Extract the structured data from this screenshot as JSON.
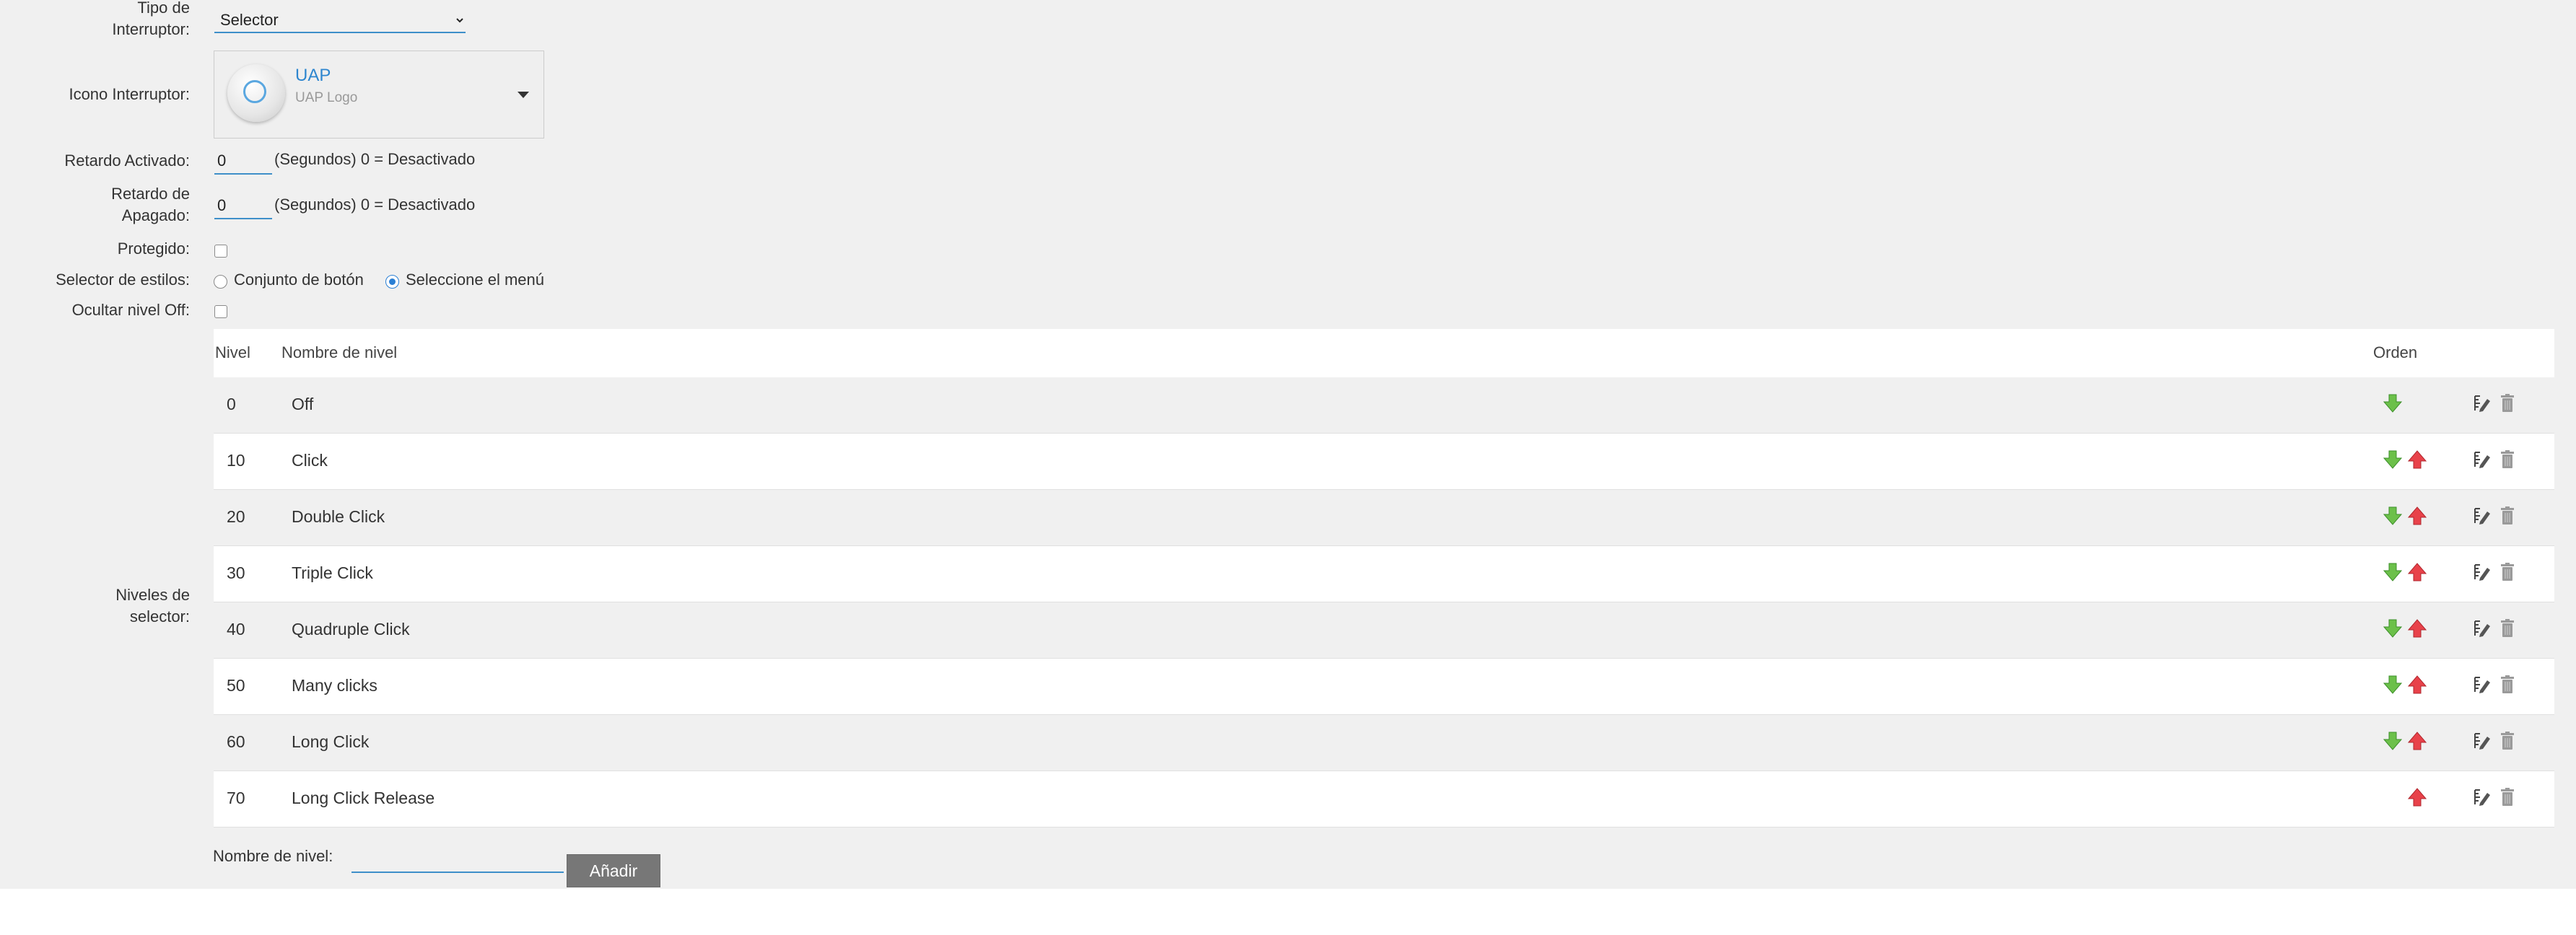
{
  "form": {
    "tipo_label": "Tipo de\nInterruptor:",
    "tipo_value": "Selector",
    "icono_label": "Icono Interruptor:",
    "icon": {
      "name": "UAP",
      "subtitle": "UAP Logo"
    },
    "retardo_activado_label": "Retardo Activado:",
    "retardo_activado_value": "0",
    "retardo_activado_hint": "(Segundos) 0 = Desactivado",
    "retardo_apagado_label": "Retardo de\nApagado:",
    "retardo_apagado_value": "0",
    "retardo_apagado_hint": "(Segundos) 0 = Desactivado",
    "protegido_label": "Protegido:",
    "protegido_checked": false,
    "estilos_label": "Selector de estilos:",
    "estilos_options": [
      "Conjunto de botón",
      "Seleccione el menú"
    ],
    "estilos_selected": "Seleccione el menú",
    "ocultar_label": "Ocultar nivel Off:",
    "ocultar_checked": false,
    "niveles_label": "Niveles de\nselector:"
  },
  "table": {
    "headers": {
      "nivel": "Nivel",
      "nombre": "Nombre de nivel",
      "orden": "Orden"
    },
    "rows": [
      {
        "nivel": "0",
        "nombre": "Off"
      },
      {
        "nivel": "10",
        "nombre": "Click"
      },
      {
        "nivel": "20",
        "nombre": "Double Click"
      },
      {
        "nivel": "30",
        "nombre": "Triple Click"
      },
      {
        "nivel": "40",
        "nombre": "Quadruple Click"
      },
      {
        "nivel": "50",
        "nombre": "Many clicks"
      },
      {
        "nivel": "60",
        "nombre": "Long Click"
      },
      {
        "nivel": "70",
        "nombre": "Long Click Release"
      }
    ]
  },
  "add": {
    "label": "Nombre de nivel:",
    "value": "",
    "button": "Añadir"
  },
  "colors": {
    "accent": "#3e8fc9",
    "arrow_down": "#6cc04a",
    "arrow_up": "#e8424a",
    "background": "#f0f0f0"
  },
  "icons": [
    "uap-device-icon",
    "dropdown-caret-icon",
    "arrow-down-icon",
    "arrow-up-icon",
    "edit-icon",
    "delete-icon"
  ]
}
